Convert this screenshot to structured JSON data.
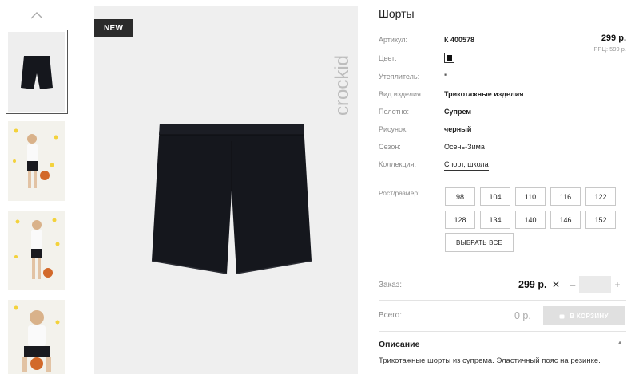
{
  "thumbnails": {
    "items": [
      {
        "alt": "thumbnail-shorts"
      },
      {
        "alt": "thumbnail-model-front"
      },
      {
        "alt": "thumbnail-model-side"
      },
      {
        "alt": "thumbnail-model-sitting"
      }
    ]
  },
  "main_image": {
    "badge": "NEW",
    "brand": "crockid"
  },
  "product": {
    "title": "Шорты",
    "price": "299 р.",
    "rrp": "РРЦ: 599 р.",
    "fields": {
      "article": {
        "label": "Артикул:",
        "value": "К 400578"
      },
      "color": {
        "label": "Цвет:",
        "swatch": "#111111"
      },
      "insulation": {
        "label": "Утеплитель:",
        "value": "\""
      },
      "type": {
        "label": "Вид изделия:",
        "value": "Трикотажные изделия"
      },
      "fabric": {
        "label": "Полотно:",
        "value": "Супрем"
      },
      "pattern": {
        "label": "Рисунок:",
        "value": "черный"
      },
      "season": {
        "label": "Сезон:",
        "value": "Осень-Зима"
      },
      "collection": {
        "label": "Коллекция:",
        "value": "Спорт, школа"
      }
    }
  },
  "sizes": {
    "label": "Рост/размер:",
    "values": [
      "98",
      "104",
      "110",
      "116",
      "122",
      "128",
      "134",
      "140",
      "146",
      "152"
    ],
    "select_all": "ВЫБРАТЬ ВСЕ"
  },
  "order": {
    "label": "Заказ:",
    "price": "299 р.",
    "times": "✕",
    "minus": "–",
    "plus": "+",
    "quantity": ""
  },
  "total": {
    "label": "Всего:",
    "value": "0 р.",
    "cart_button": "В КОРЗИНУ"
  },
  "description": {
    "heading": "Описание",
    "toggle": "▲",
    "text": "Трикотажные шорты из супрема. Эластичный пояс на резинке."
  },
  "colors": {
    "garment": "#15171d",
    "badge": "#2b2b2b",
    "cart_disabled": "#e0e0e0"
  }
}
